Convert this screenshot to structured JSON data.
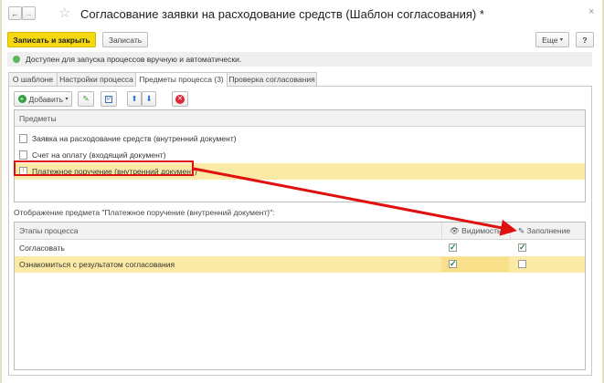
{
  "window": {
    "title": "Согласование заявки на расходование средств (Шаблон согласования) *",
    "back": "←",
    "forward": "→",
    "star": "☆",
    "close": "×"
  },
  "toolbar": {
    "save_close": "Записать и закрыть",
    "save": "Записать",
    "more": "Еще",
    "more_arrow": "▾",
    "help": "?"
  },
  "info": {
    "text": "Доступен для запуска процессов вручную и автоматически."
  },
  "tabs": [
    {
      "label": "О шаблоне"
    },
    {
      "label": "Настройки процесса"
    },
    {
      "label": "Предметы процесса (3)"
    },
    {
      "label": "Проверка согласования"
    }
  ],
  "subjects_toolbar": {
    "add": "Добавить",
    "add_arrow": "▾"
  },
  "subjects": {
    "header": "Предметы",
    "items": [
      {
        "label": "Заявка на расходование средств (внутренний документ)"
      },
      {
        "label": "Счет на оплату (входящий документ)"
      },
      {
        "label": "Платежное поручение (внутренний документ)"
      }
    ]
  },
  "display": {
    "label": "Отображение предмета \"Платежное поручение (внутренний документ)\":",
    "columns": {
      "stages": "Этапы процесса",
      "visibility": "Видимость",
      "filling": "Заполнение"
    },
    "rows": [
      {
        "stage": "Согласовать",
        "visibility": true,
        "filling": true
      },
      {
        "stage": "Ознакомиться с результатом согласования",
        "visibility": true,
        "filling": false
      }
    ]
  },
  "colors": {
    "accent": "#f5d80f",
    "selection": "#fbeaa5",
    "annotation": "#e01010"
  }
}
